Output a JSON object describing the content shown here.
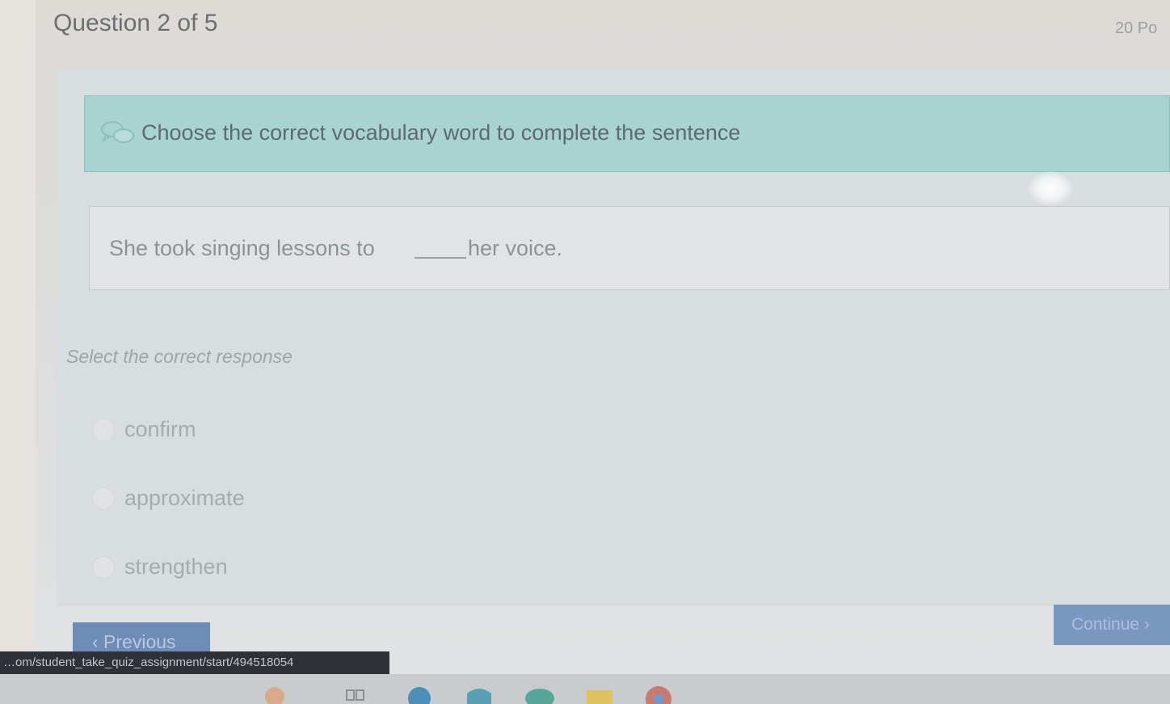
{
  "header": {
    "question_counter": "Question 2 of 5",
    "points": "20 Po"
  },
  "instruction": {
    "icon": "chat-bubbles-icon",
    "text": "Choose the correct vocabulary word to complete the sentence"
  },
  "sentence": {
    "before_blank": "She took singing lessons to",
    "after_blank": "her voice."
  },
  "prompt": "Select the correct response",
  "options": [
    {
      "label": "confirm",
      "selected": false
    },
    {
      "label": "approximate",
      "selected": false
    },
    {
      "label": "strengthen",
      "selected": false
    }
  ],
  "buttons": {
    "previous_label": "‹ Previous",
    "continue_label": "Continue ›"
  },
  "status_bar": {
    "url": "…om/student_take_quiz_assignment/start/494518054"
  },
  "colors": {
    "instruction_bg": "#a9d3d1",
    "button_blue": "#6f8cb7"
  }
}
